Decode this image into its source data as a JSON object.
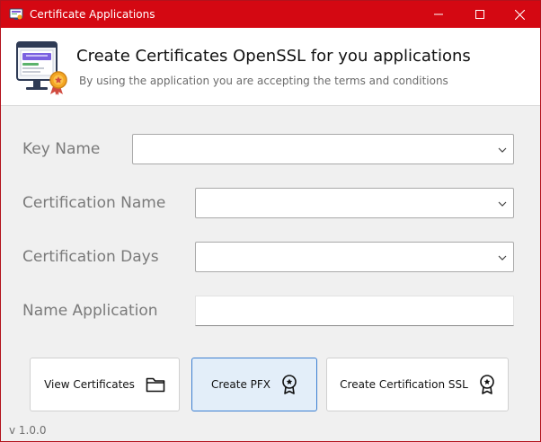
{
  "window": {
    "title": "Certificate Applications",
    "accent_color": "#d40812",
    "controls": [
      "minimize-icon",
      "maximize-icon",
      "close-icon"
    ]
  },
  "header": {
    "title": "Create Certificates OpenSSL for you applications",
    "subtitle": "By using the application you are accepting the terms and conditions",
    "illustration": "computer-certificate-icon"
  },
  "form": {
    "key_name": {
      "label": "Key Name",
      "value": ""
    },
    "certification_name": {
      "label": "Certification Name",
      "value": ""
    },
    "certification_days": {
      "label": "Certification Days",
      "value": ""
    },
    "name_application": {
      "label": "Name Application",
      "value": ""
    }
  },
  "buttons": {
    "view_certificates": {
      "label": "View Certificates",
      "icon": "folder-icon"
    },
    "create_pfx": {
      "label": "Create PFX",
      "icon": "award-icon"
    },
    "create_ssl": {
      "label": "Create Certification SSL",
      "icon": "award-icon"
    }
  },
  "version": "v 1.0.0"
}
